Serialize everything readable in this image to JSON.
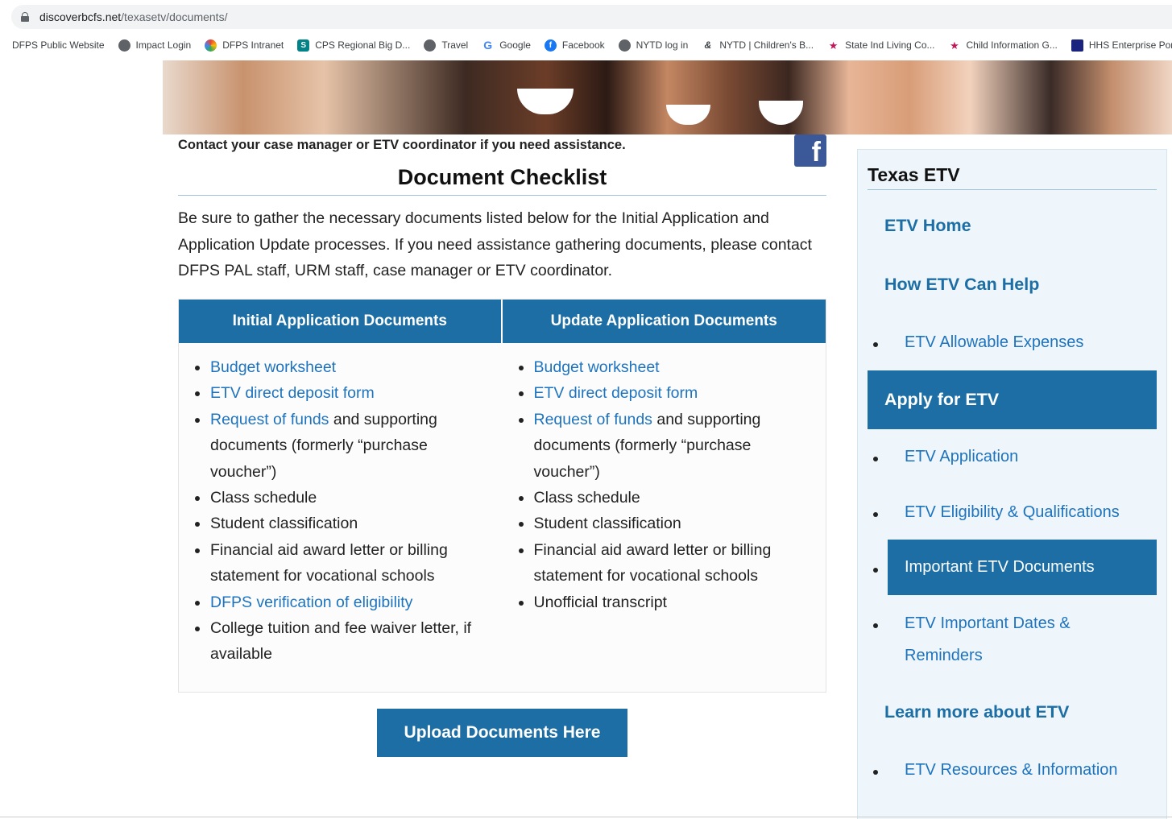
{
  "browser": {
    "url_host": "discoverbcfs.net",
    "url_path": "/texasetv/documents/"
  },
  "bookmarks": [
    {
      "label": "DFPS Public Website",
      "icon": "none"
    },
    {
      "label": "Impact Login",
      "icon": "globe-icon"
    },
    {
      "label": "DFPS Intranet",
      "icon": "rainbow-icon"
    },
    {
      "label": "CPS Regional Big D...",
      "icon": "sharepoint-icon"
    },
    {
      "label": "Travel",
      "icon": "globe-icon"
    },
    {
      "label": "Google",
      "icon": "google-icon"
    },
    {
      "label": "Facebook",
      "icon": "facebook-icon"
    },
    {
      "label": "NYTD log in",
      "icon": "globe-icon"
    },
    {
      "label": "NYTD | Children's B...",
      "icon": "nytd-icon"
    },
    {
      "label": "State Ind Living Co...",
      "icon": "texas-icon"
    },
    {
      "label": "Child Information G...",
      "icon": "texas-icon"
    },
    {
      "label": "HHS Enterprise Por",
      "icon": "hhs-icon"
    }
  ],
  "main": {
    "contact_note": "Contact your case manager or ETV coordinator if you need assistance.",
    "title": "Document Checklist",
    "intro": "Be sure to gather the necessary documents listed below for the Initial Application and Application Update processes. If you need assistance gathering documents, please contact DFPS PAL staff, URM staff, case manager or ETV coordinator.",
    "initial": {
      "header": "Initial Application Documents",
      "items": {
        "budget": "Budget worksheet",
        "deposit": "ETV direct deposit form",
        "request_link": "Request of funds",
        "request_rest": " and supporting documents (formerly “purchase voucher”)",
        "schedule": "Class schedule",
        "classification": "Student classification",
        "finaid": "Financial aid award letter or billing statement for vocational schools",
        "verification": "DFPS verification of eligibility",
        "waiver": "College tuition and fee waiver letter, if available"
      }
    },
    "update": {
      "header": "Update Application Documents",
      "items": {
        "budget": "Budget worksheet",
        "deposit": "ETV direct deposit form",
        "request_link": "Request of funds",
        "request_rest": " and supporting documents (formerly “purchase voucher”)",
        "schedule": "Class schedule",
        "classification": "Student classification",
        "finaid": "Financial aid award letter or billing statement for vocational schools",
        "transcript": "Unofficial transcript"
      }
    },
    "upload_button": "Upload Documents Here"
  },
  "sidebar": {
    "title": "Texas ETV",
    "etv_home": "ETV Home",
    "how_help": "How ETV Can Help",
    "allowable": "ETV Allowable Expenses",
    "apply": "Apply for ETV",
    "application": "ETV Application",
    "eligibility": "ETV Eligibility & Qualifications",
    "important_docs": "Important ETV Documents",
    "dates_line1": "ETV Important Dates &",
    "dates_line2": "Reminders",
    "learn_more": "Learn more about ETV",
    "resources": "ETV Resources & Information"
  },
  "colors": {
    "brand_blue": "#1c6ea4",
    "link_blue": "#1e73be",
    "sidebar_bg": "#eef6fb"
  }
}
